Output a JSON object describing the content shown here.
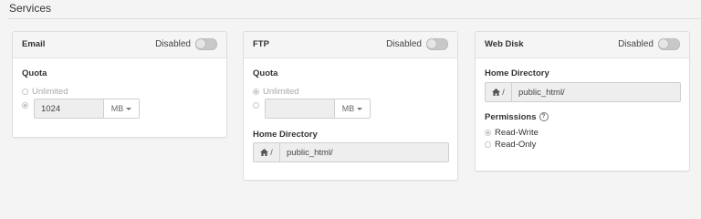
{
  "section": {
    "title": "Services"
  },
  "email": {
    "title": "Email",
    "toggle_label": "Disabled",
    "quota_label": "Quota",
    "unlimited_label": "Unlimited",
    "quota_value": "1024",
    "unit": "MB"
  },
  "ftp": {
    "title": "FTP",
    "toggle_label": "Disabled",
    "quota_label": "Quota",
    "unlimited_label": "Unlimited",
    "quota_value": "",
    "unit": "MB",
    "home_dir_label": "Home Directory",
    "path_prefix": "/",
    "home_dir_value": "public_html/"
  },
  "webdisk": {
    "title": "Web Disk",
    "toggle_label": "Disabled",
    "home_dir_label": "Home Directory",
    "path_prefix": "/",
    "home_dir_value": "public_html/",
    "permissions_label": "Permissions",
    "read_write_label": "Read-Write",
    "read_only_label": "Read-Only"
  },
  "icons": {
    "home": "home-icon",
    "help": "question-circle-icon",
    "caret": "caret-down-icon"
  },
  "colors": {
    "toggle_off": "#c8c8c8",
    "header_bg": "#f5f5f5",
    "card_border": "#dedede"
  }
}
